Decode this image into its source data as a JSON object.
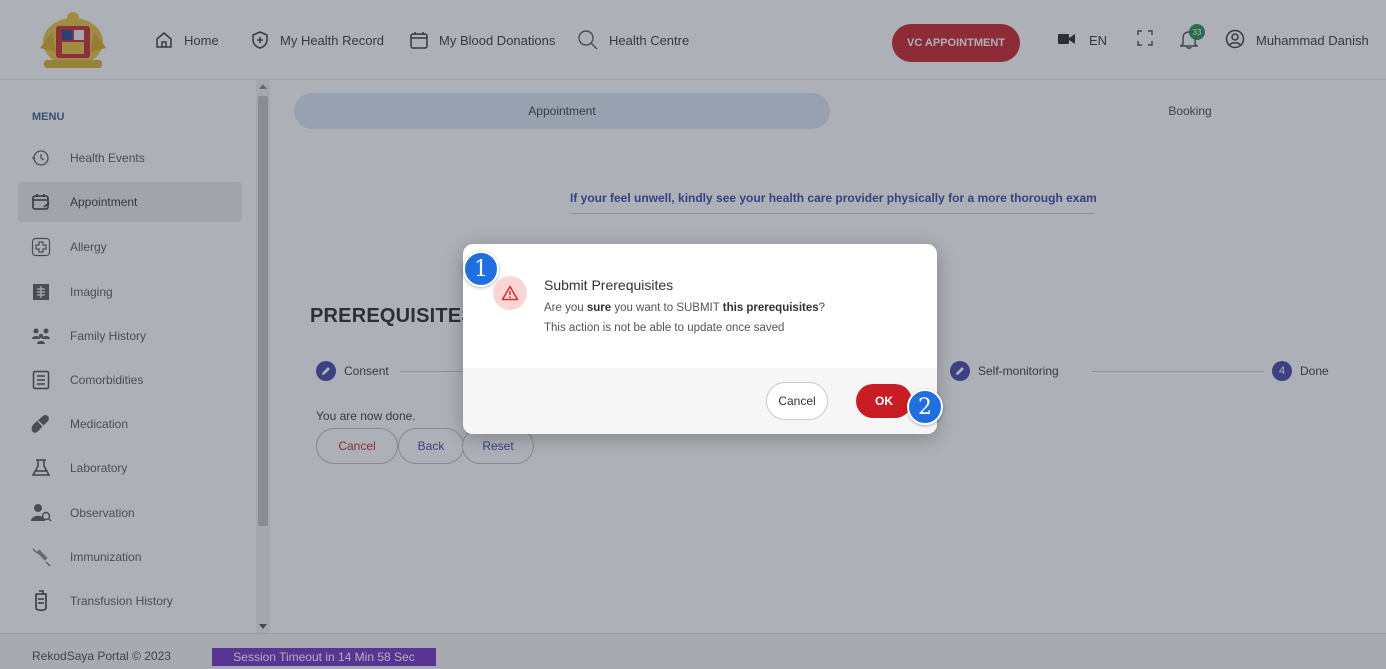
{
  "header": {
    "logo_alt": "Jata Negara Malaysia",
    "nav": [
      {
        "label": "Home",
        "icon": "home-icon"
      },
      {
        "label": "My Health Record",
        "icon": "shield-icon"
      },
      {
        "label": "My Blood Donations",
        "icon": "calendar-icon"
      },
      {
        "label": "Health Centre",
        "icon": "search-icon"
      }
    ],
    "vc_button": "VC APPOINTMENT",
    "language": "EN",
    "notification_count": "33",
    "user_name": "Muhammad Danish"
  },
  "sidebar": {
    "title": "MENU",
    "items": [
      {
        "label": "Health Events",
        "icon": "history-icon",
        "active": false
      },
      {
        "label": "Appointment",
        "icon": "calendar-edit-icon",
        "active": true
      },
      {
        "label": "Allergy",
        "icon": "medical-cross-icon",
        "active": false
      },
      {
        "label": "Imaging",
        "icon": "imaging-icon",
        "active": false
      },
      {
        "label": "Family History",
        "icon": "family-icon",
        "active": false
      },
      {
        "label": "Comorbidities",
        "icon": "document-icon",
        "active": false
      },
      {
        "label": "Medication",
        "icon": "pill-icon",
        "active": false
      },
      {
        "label": "Laboratory",
        "icon": "flask-icon",
        "active": false
      },
      {
        "label": "Observation",
        "icon": "observation-icon",
        "active": false
      },
      {
        "label": "Immunization",
        "icon": "syringe-icon",
        "active": false
      },
      {
        "label": "Transfusion History",
        "icon": "blood-bag-icon",
        "active": false
      }
    ]
  },
  "main": {
    "tabs": [
      {
        "label": "Appointment"
      },
      {
        "label": "Booking"
      }
    ],
    "notice": "If your feel unwell, kindly see your health care provider physically for a more thorough exam",
    "card": {
      "title": "PREREQUISITES",
      "steps": [
        {
          "label": "Consent",
          "marker": "pencil-icon"
        },
        {
          "label": "Self-monitoring",
          "marker": "pencil-icon"
        },
        {
          "label": "Done",
          "marker": "4"
        }
      ],
      "done_text": "You are now done.",
      "buttons": {
        "cancel": "Cancel",
        "back": "Back",
        "reset": "Reset"
      }
    }
  },
  "dialog": {
    "title": "Submit Prerequisites",
    "line1": {
      "prefix": "Are you ",
      "bold1": "sure",
      "middle": " you want to SUBMIT ",
      "bold2": "this prerequisites",
      "suffix": "?"
    },
    "line2": "This action is not be able to update once saved",
    "cancel_label": "Cancel",
    "ok_label": "OK"
  },
  "markers": [
    "1",
    "2"
  ],
  "footer": {
    "copyright": "RekodSaya Portal © 2023",
    "session": "Session Timeout in 14 Min 58 Sec"
  },
  "colors": {
    "accent_red": "#c81d25",
    "step_blue": "#3e3ea8",
    "session_purple": "#6d2cc6",
    "notice_blue": "#3140a8",
    "tab_active_bg": "#dbe6f5"
  }
}
